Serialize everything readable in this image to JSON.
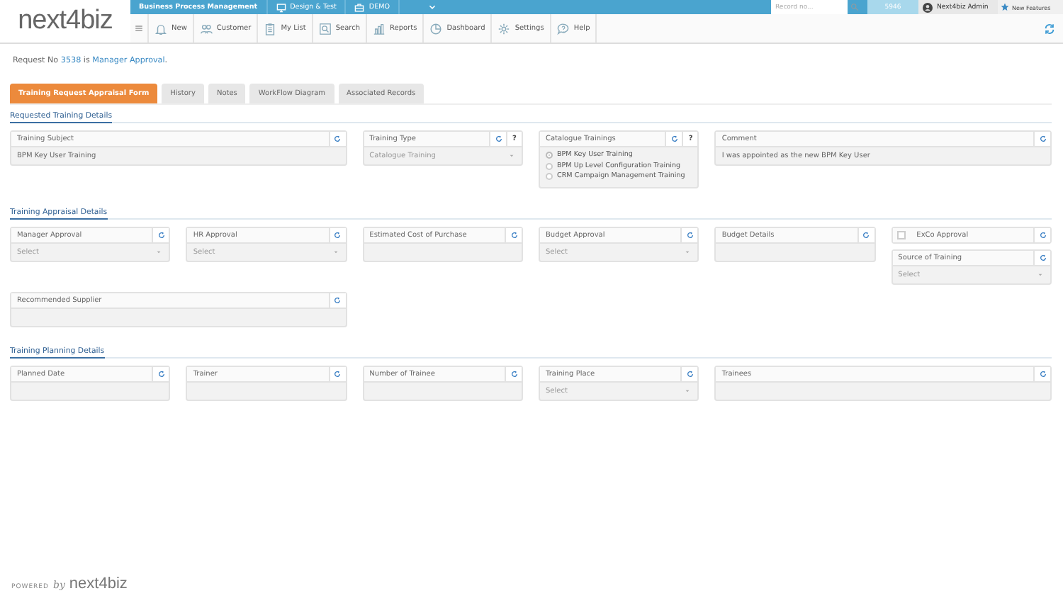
{
  "logo": {
    "text": "next4biz"
  },
  "top_bar": {
    "items": [
      {
        "label": "Business Process Management",
        "kind": "title"
      },
      {
        "label": "Design & Test",
        "kind": "monitor"
      },
      {
        "label": "DEMO",
        "kind": "briefcase"
      }
    ],
    "record_search": {
      "placeholder": "Record no..."
    },
    "record_button": "5946",
    "user": "Next4biz Admin",
    "new_features": "New Features"
  },
  "toolbar": [
    {
      "label": "New",
      "kind": "bell"
    },
    {
      "label": "Customer",
      "kind": "people"
    },
    {
      "label": "My List",
      "kind": "clipboard"
    },
    {
      "label": "Search",
      "kind": "search"
    },
    {
      "label": "Reports",
      "kind": "bars"
    },
    {
      "label": "Dashboard",
      "kind": "pie"
    },
    {
      "label": "Settings",
      "kind": "gear"
    },
    {
      "label": "Help",
      "kind": "help"
    }
  ],
  "request_status": {
    "prefix": "Request No",
    "number": "3538",
    "middle": "is",
    "status": "Manager Approval",
    "suffix": "."
  },
  "tabs": [
    {
      "label": "Training Request Appraisal Form",
      "selected": true
    },
    {
      "label": "History",
      "selected": false
    },
    {
      "label": "Notes",
      "selected": false
    },
    {
      "label": "WorkFlow Diagram",
      "selected": false
    },
    {
      "label": "Associated Records",
      "selected": false
    }
  ],
  "sections": [
    {
      "title": "Requested Training Details",
      "rows": [
        [
          {
            "label": "Training Subject",
            "kind": "wide_text",
            "value": "BPM Key User Training"
          },
          {
            "label": "Training Type",
            "kind": "select",
            "value": "Catalogue Training",
            "help": "?"
          },
          {
            "label": "Catalogue Trainings",
            "kind": "radio_list",
            "help": "?",
            "options": [
              {
                "label": "BPM Key User Training",
                "selected": true
              },
              {
                "label": "BPM Up Level Configuration Training",
                "selected": false
              },
              {
                "label": "CRM Campaign Management Training",
                "selected": false
              }
            ]
          },
          {
            "label": "Comment",
            "kind": "wide_text",
            "value": "I was appointed as the new BPM Key User"
          }
        ]
      ]
    },
    {
      "title": "Training Appraisal Details",
      "rows": [
        [
          {
            "label": "Manager Approval",
            "kind": "select",
            "placeholder": "Select"
          },
          {
            "label": "HR Approval",
            "kind": "select",
            "placeholder": "Select"
          },
          {
            "label": "Estimated Cost of Purchase",
            "kind": "text"
          },
          {
            "label": "Budget Approval",
            "kind": "select",
            "placeholder": "Select"
          },
          {
            "label": "Budget Details",
            "kind": "text"
          },
          {
            "kind": "stack",
            "fields": [
              {
                "label": "ExCo Approval",
                "kind": "check",
                "checked": false
              },
              {
                "label": "Source of Training",
                "kind": "select",
                "placeholder": "Select"
              }
            ]
          }
        ],
        [
          {
            "label": "Recommended Supplier",
            "kind": "wide_text"
          }
        ]
      ]
    },
    {
      "title": "Training Planning Details",
      "rows": [
        [
          {
            "label": "Planned Date",
            "kind": "text"
          },
          {
            "label": "Trainer",
            "kind": "text"
          },
          {
            "label": "Number of Trainee",
            "kind": "text"
          },
          {
            "label": "Training Place",
            "kind": "select",
            "placeholder": "Select"
          },
          {
            "label": "Trainees",
            "kind": "wide_text"
          }
        ]
      ]
    }
  ],
  "footer": {
    "powered": "POWERED",
    "by": "by",
    "logo": "next4biz"
  }
}
